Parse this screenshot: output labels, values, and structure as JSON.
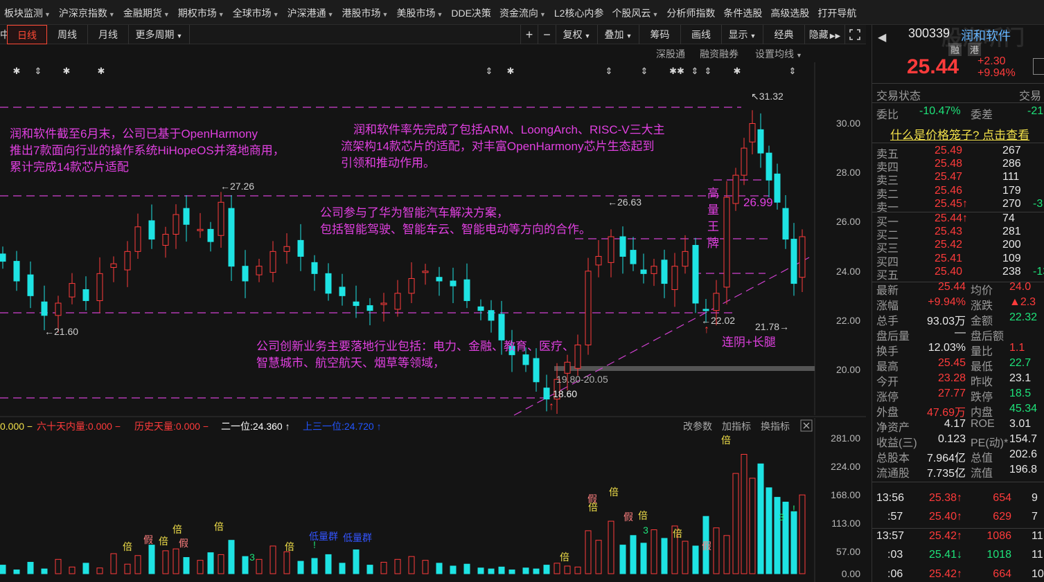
{
  "top_menu": [
    {
      "label": "板块监测",
      "arrow": true
    },
    {
      "label": "沪深京指数",
      "arrow": true
    },
    {
      "label": "金融期货",
      "arrow": true
    },
    {
      "label": "期权市场",
      "arrow": true
    },
    {
      "label": "全球市场",
      "arrow": true
    },
    {
      "label": "沪深港通",
      "arrow": true
    },
    {
      "label": "港股市场",
      "arrow": true
    },
    {
      "label": "美股市场",
      "arrow": true
    },
    {
      "label": "DDE决策",
      "arrow": false
    },
    {
      "label": "资金流向",
      "arrow": true
    },
    {
      "label": "L2核心内参",
      "arrow": false
    },
    {
      "label": "个股风云",
      "arrow": true
    },
    {
      "label": "分析师指数",
      "arrow": false
    },
    {
      "label": "条件选股",
      "arrow": false
    },
    {
      "label": "高级选股",
      "arrow": false
    },
    {
      "label": "打开导航",
      "arrow": false
    }
  ],
  "toolbar": {
    "left_stub": "中",
    "periods": [
      "日线",
      "周线",
      "月线",
      "更多周期"
    ],
    "active_period": "日线",
    "tools": [
      "+",
      "−",
      "复权",
      "叠加",
      "筹码",
      "画线",
      "显示",
      "经典",
      "隐藏"
    ],
    "expand_icon": "expand-icon"
  },
  "subbar": {
    "items": [
      "深股通",
      "融资融券",
      "设置均线"
    ]
  },
  "chart": {
    "y_axis_labels": [
      "30.00",
      "28.00",
      "26.00",
      "24.00",
      "22.00",
      "20.00"
    ],
    "vol_axis_labels": [
      "281.00",
      "224.00",
      "168.00",
      "113.00",
      "57.00",
      "0.00"
    ],
    "price_markers": {
      "high": "31.32",
      "p2726": "27.26",
      "p2663": "26.63",
      "p2160": "21.60",
      "p2202": "22.02",
      "p2178": "21.78",
      "low": "18.60",
      "range": "19.80-20.05",
      "p2699": "26.99"
    },
    "annotations": {
      "a1": [
        "润和软件截至6月末，公司已基于OpenHarmony",
        "推出7款面向行业的操作系统HiHopeOS并落地商用，",
        "累计完成14款芯片适配"
      ],
      "a2": [
        "润和软件率先完成了包括ARM、LoongArch、RISC-V三大主",
        "流架构14款芯片的适配，对丰富OpenHarmony芯片生态起到",
        "引领和推动作用。"
      ],
      "a3": [
        "公司参与了华为智能汽车解决方案，",
        "包括智能驾驶、智能车云、智能电动等方向的合作。"
      ],
      "a4": [
        "公司创新业务主要落地行业包括：电力、金融、教育、医疗、",
        "智慧城市、航空航天、烟草等领域，"
      ],
      "vertical": [
        "高",
        "量",
        "王",
        "牌"
      ],
      "pattern": "连阴+长腿"
    },
    "indicator_bar": {
      "i1": "0.000",
      "i2": "六十天内量:0.000",
      "i3": "历史天量:0.000",
      "i4": "二一位:24.360",
      "i5": "上三一位:24.720",
      "btns": [
        "改参数",
        "加指标",
        "换指标"
      ]
    },
    "vol_marks": {
      "bei": "倍",
      "jia": "假",
      "three": "3",
      "excl": "!",
      "dlz": "低量群"
    }
  },
  "quote": {
    "code": "300339",
    "name": "润和软件",
    "tags": [
      "融",
      "港"
    ],
    "price": "25.44",
    "change": "+2.30",
    "change_pct": "+9.94%",
    "status_label": "交易状态",
    "status_right": "交易",
    "weibi_label": "委比",
    "weibi": "-10.47%",
    "weicha_label": "委差",
    "weicha": "-21",
    "promo": "什么是价格笼子? 点击查看",
    "asks": [
      {
        "label": "卖五",
        "price": "25.49",
        "vol": "267",
        "tail": ""
      },
      {
        "label": "卖四",
        "price": "25.48",
        "vol": "286",
        "tail": ""
      },
      {
        "label": "卖三",
        "price": "25.47",
        "vol": "111",
        "tail": ""
      },
      {
        "label": "卖二",
        "price": "25.46",
        "vol": "179",
        "tail": ""
      },
      {
        "label": "卖一",
        "price": "25.45↑",
        "vol": "270",
        "tail": "-3"
      }
    ],
    "bids": [
      {
        "label": "买一",
        "price": "25.44↑",
        "vol": "74",
        "tail": ""
      },
      {
        "label": "买二",
        "price": "25.43",
        "vol": "281",
        "tail": ""
      },
      {
        "label": "买三",
        "price": "25.42",
        "vol": "200",
        "tail": ""
      },
      {
        "label": "买四",
        "price": "25.41",
        "vol": "109",
        "tail": ""
      },
      {
        "label": "买五",
        "price": "25.40",
        "vol": "238",
        "tail": "-13"
      }
    ],
    "stats": [
      {
        "l1": "最新",
        "v1": "25.44",
        "c1": "red",
        "l2": "均价",
        "v2": "24.0",
        "c2": "red"
      },
      {
        "l1": "涨幅",
        "v1": "+9.94%",
        "c1": "red",
        "l2": "涨跌",
        "v2": "▲2.3",
        "c2": "red"
      },
      {
        "l1": "总手",
        "v1": "93.03万",
        "c1": "white",
        "l2": "金额",
        "v2": "22.32",
        "c2": "green"
      },
      {
        "l1": "盘后量",
        "v1": "—",
        "c1": "white",
        "l2": "盘后额",
        "v2": "",
        "c2": "white"
      },
      {
        "l1": "换手",
        "v1": "12.03%",
        "c1": "white",
        "l2": "量比",
        "v2": "1.1",
        "c2": "red"
      },
      {
        "l1": "最高",
        "v1": "25.45",
        "c1": "red",
        "l2": "最低",
        "v2": "22.7",
        "c2": "green"
      },
      {
        "l1": "今开",
        "v1": "23.28",
        "c1": "red",
        "l2": "昨收",
        "v2": "23.1",
        "c2": "white"
      },
      {
        "l1": "涨停",
        "v1": "27.77",
        "c1": "red",
        "l2": "跌停",
        "v2": "18.5",
        "c2": "green"
      },
      {
        "l1": "外盘",
        "v1": "47.69万",
        "c1": "red",
        "l2": "内盘",
        "v2": "45.34",
        "c2": "green"
      },
      {
        "l1": "净资产",
        "v1": "4.17",
        "c1": "white",
        "l2": "ROE",
        "v2": "3.01",
        "c2": "white"
      },
      {
        "l1": "收益(三)",
        "v1": "0.123",
        "c1": "white",
        "l2": "PE(动)*",
        "v2": "154.7",
        "c2": "white"
      },
      {
        "l1": "总股本",
        "v1": "7.964亿",
        "c1": "white",
        "l2": "总值",
        "v2": "202.6",
        "c2": "white"
      },
      {
        "l1": "流通股",
        "v1": "7.735亿",
        "c1": "white",
        "l2": "流值",
        "v2": "196.8",
        "c2": "white"
      }
    ],
    "ticks": [
      {
        "time": "13:56",
        "price": "25.38↑",
        "pc": "red",
        "vol": "654",
        "vc": "red",
        "tail": "9"
      },
      {
        "time": ":57",
        "price": "25.40↑",
        "pc": "red",
        "vol": "629",
        "vc": "red",
        "tail": "7"
      },
      {
        "time": "13:57",
        "price": "25.42↑",
        "pc": "red",
        "vol": "1086",
        "vc": "red",
        "tail": "11"
      },
      {
        "time": ":03",
        "price": "25.41↓",
        "pc": "green",
        "vol": "1018",
        "vc": "green",
        "tail": "11"
      },
      {
        "time": ":06",
        "price": "25.42↑",
        "pc": "red",
        "vol": "664",
        "vc": "red",
        "tail": "10"
      }
    ],
    "watermark": "股海听门"
  },
  "colors": {
    "up": "#ff3b3b",
    "down": "#1ee3e3",
    "annotation": "#e040e0",
    "dashed": "#d040d0",
    "background": "#141414",
    "active": "#ff4a35"
  }
}
